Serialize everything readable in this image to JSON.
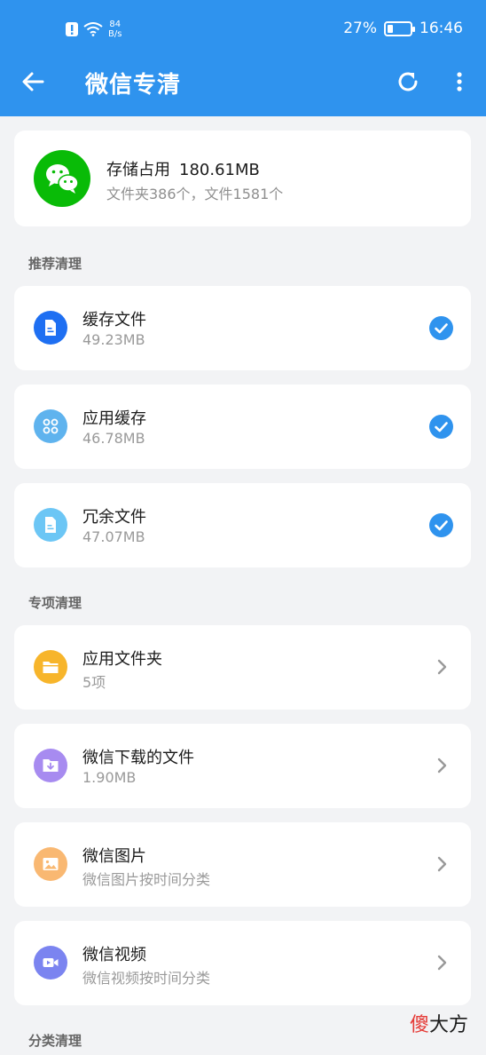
{
  "status_bar": {
    "speed_value": "84",
    "speed_unit": "B/s",
    "battery": "27%",
    "battery_level": 0.27,
    "time": "16:46"
  },
  "app_bar": {
    "title": "微信专清"
  },
  "summary": {
    "storage_label": "存储占用",
    "storage_value": "180.61MB",
    "counts": "文件夹386个，文件1581个"
  },
  "recommended": {
    "title": "推荐清理",
    "items": [
      {
        "label": "缓存文件",
        "value": "49.23MB",
        "icon": "file-icon",
        "color": "#1e6ff2",
        "checked": true
      },
      {
        "label": "应用缓存",
        "value": "46.78MB",
        "icon": "apps-icon",
        "color": "#5fb3ee",
        "checked": true
      },
      {
        "label": "冗余文件",
        "value": "47.07MB",
        "icon": "document-icon",
        "color": "#6cc6f5",
        "checked": true
      }
    ]
  },
  "special": {
    "title": "专项清理",
    "items": [
      {
        "label": "应用文件夹",
        "value": "5项",
        "icon": "folder-icon",
        "color": "#f7b52b"
      },
      {
        "label": "微信下载的文件",
        "value": "1.90MB",
        "icon": "download-icon",
        "color": "#a78bf0"
      },
      {
        "label": "微信图片",
        "value": "微信图片按时间分类",
        "icon": "image-icon",
        "color": "#f9b872"
      },
      {
        "label": "微信视频",
        "value": "微信视频按时间分类",
        "icon": "video-icon",
        "color": "#7b84f0"
      }
    ]
  },
  "category": {
    "title": "分类清理"
  },
  "watermark": {
    "part1": "傻",
    "part2": "大方"
  }
}
